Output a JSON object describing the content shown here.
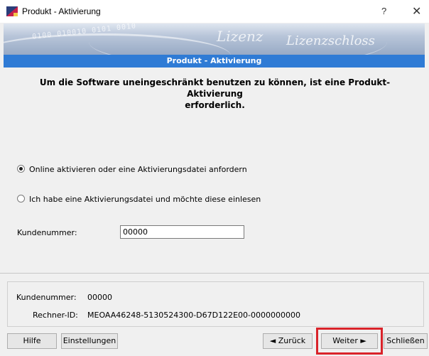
{
  "window": {
    "title": "Produkt - Aktivierung",
    "help_glyph": "?",
    "close_glyph": "✕"
  },
  "banner": {
    "logo_text_1": "Lizenz",
    "logo_text_2": "Lizenzschloss",
    "decor_digits": "0100 010010 0101 0010",
    "heading": "Produkt - Aktivierung"
  },
  "main": {
    "intro_line1": "Um die Software uneingeschränkt benutzen zu können, ist eine Produkt-Aktivierung",
    "intro_line2": "erforderlich.",
    "options": [
      {
        "label": "Online aktivieren oder eine Aktivierungsdatei anfordern",
        "selected": true
      },
      {
        "label": "Ich habe eine Aktivierungsdatei und möchte diese einlesen",
        "selected": false
      }
    ],
    "customer_label": "Kundenummer:",
    "customer_value": "00000"
  },
  "info": {
    "customer_label": "Kundenummer:",
    "customer_value": "00000",
    "computer_label": "Rechner-ID:",
    "computer_value": "MEOAA46248-5130524300-D67D122E00-0000000000"
  },
  "footer": {
    "help_label": "Hilfe",
    "settings_label": "Einstellungen",
    "back_label": "◄ Zurück",
    "next_label": "Weiter ►",
    "close_label": "Schließen"
  },
  "colors": {
    "accent": "#2f7bd5",
    "highlight": "#d9232a"
  }
}
